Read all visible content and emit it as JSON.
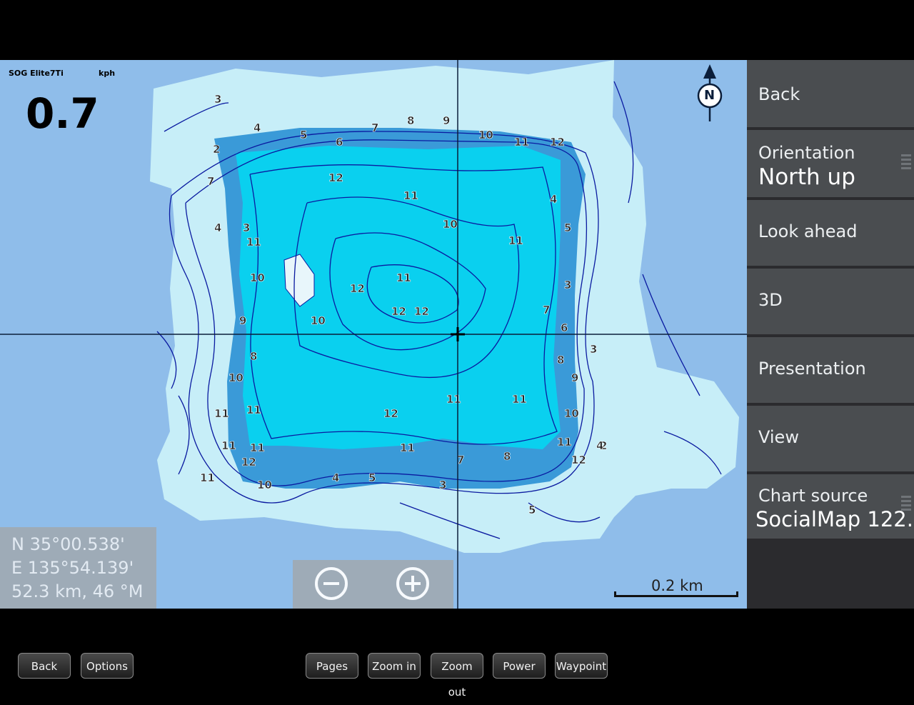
{
  "sog": {
    "label": "SOG Elite7Ti",
    "unit": "kph",
    "value": "0.7"
  },
  "compass": {
    "letter": "N"
  },
  "position": {
    "lat": "N  35°00.538'",
    "lon": "E 135°54.139'",
    "range": "52.3 km, 46 °M"
  },
  "scale": {
    "label": "0.2 km"
  },
  "menu": {
    "back": "Back",
    "orientation_label": "Orientation",
    "orientation_value": "North up",
    "look_ahead": "Look ahead",
    "three_d": "3D",
    "presentation": "Presentation",
    "view": "View",
    "chart_source_label": "Chart source",
    "chart_source_value": "SocialMap 122..."
  },
  "toolbar": {
    "back": "Back",
    "options": "Options",
    "pages": "Pages",
    "zoom_in": "Zoom in",
    "zoom_out": "Zoom out",
    "power": "Power",
    "waypoint": "Waypoint"
  },
  "depths": [
    "3",
    "4",
    "5",
    "6",
    "7",
    "8",
    "9",
    "10",
    "11",
    "12",
    "12",
    "11",
    "10",
    "11",
    "11",
    "12",
    "12",
    "12",
    "10",
    "11",
    "11",
    "12",
    "11",
    "8",
    "7",
    "5",
    "4",
    "3",
    "2",
    "7",
    "4",
    "3",
    "11",
    "10",
    "9",
    "8",
    "10",
    "11",
    "11",
    "11",
    "12",
    "11",
    "10",
    "11",
    "4",
    "5",
    "3",
    "7",
    "6",
    "8",
    "9",
    "10",
    "11",
    "12",
    "2",
    "3",
    "4",
    "5"
  ],
  "colors": {
    "deep": "#0ad0ef",
    "mid": "#3a9ad8",
    "shallow": "#c7eef8",
    "contour": "#0a1aa0",
    "water": "#8fbdea"
  }
}
